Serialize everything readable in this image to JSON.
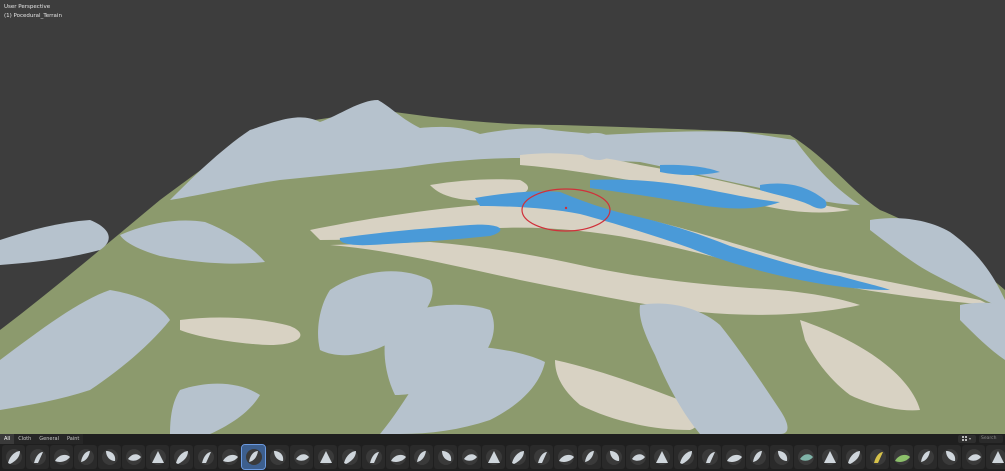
{
  "viewport": {
    "perspective_label": "User Perspective",
    "object_label": "(1) Pocedural_Terrain"
  },
  "colors": {
    "background": "#3d3d3d",
    "grass": "#8c9a6d",
    "rock": "#b6c2cd",
    "sand": "#d8d2c3",
    "water": "#4a9ad8",
    "brush_cursor": "#d0303a",
    "selection": "#3d5f8e"
  },
  "shelf": {
    "tabs": [
      "All",
      "Cloth",
      "General",
      "Paint"
    ],
    "active_tab": "All",
    "search_placeholder": "Search",
    "brushes": [
      "draw-brush-icon",
      "draw-sharp-brush-icon",
      "clay-brush-icon",
      "clay-strips-brush-icon",
      "clay-thumb-brush-icon",
      "layer-brush-icon",
      "inflate-brush-icon",
      "blob-brush-icon",
      "crease-brush-icon",
      "smooth-brush-icon",
      "flatten-brush-icon",
      "fill-brush-icon",
      "scrape-brush-icon",
      "multiplane-scrape-brush-icon",
      "pinch-brush-icon",
      "grab-brush-icon",
      "elastic-deform-brush-icon",
      "snake-hook-brush-icon",
      "thumb-brush-icon",
      "pose-brush-icon",
      "nudge-brush-icon",
      "rotate-brush-icon",
      "slide-relax-brush-icon",
      "boundary-brush-icon",
      "cloth-brush-icon",
      "simplify-brush-icon",
      "mask-brush-icon",
      "draw-face-sets-brush-icon",
      "multires-displacement-eraser-icon",
      "multires-displacement-smear-icon",
      "paint-brush-icon",
      "smear-brush-icon",
      "twist-brush-icon",
      "spiral-brush-icon",
      "smooth-paint-icon",
      "hatch-brush-icon",
      "vertex-color-brush-icon",
      "noise-brush-icon",
      "sand-brush-icon",
      "rock-brush-icon",
      "erode-brush-icon",
      "crater-brush-icon",
      "ridge-brush-icon"
    ],
    "selected_brush_index": 10
  }
}
